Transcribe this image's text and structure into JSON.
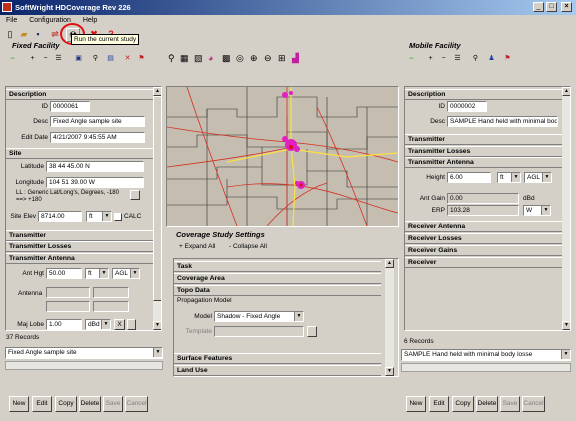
{
  "window": {
    "title": "SoftWright HDCoverage Rev 226",
    "min": "_",
    "max": "□",
    "close": "×"
  },
  "menu": [
    "File",
    "Configuration",
    "Help"
  ],
  "tooltip": "Run the current study",
  "fixed": {
    "panel_title": "Fixed Facility",
    "description": {
      "heading": "Description",
      "id_label": "ID",
      "id": "0000061",
      "desc_label": "Desc",
      "desc": "Fixed Angle sample site",
      "date_label": "Edit Date",
      "date": "4/21/2007 9:45:55 AM"
    },
    "site": {
      "heading": "Site",
      "lat_label": "Latitude",
      "lat": "38 44 45.00 N",
      "lon_label": "Longitude",
      "lon": "104 51 39.00 W",
      "ll_label": "LL : Generic Lat/Long's, Degrees, -180 ==> +180",
      "elev_label": "Site Elev",
      "elev": "8714.00",
      "elev_unit": "ft",
      "calc": "CALC"
    },
    "transmitter": "Transmitter",
    "losses": "Transmitter Losses",
    "antenna": {
      "heading": "Transmitter Antenna",
      "hgt_label": "Ant Hgt",
      "hgt": "50.00",
      "hgt_unit": "ft",
      "hgt_ref": "AGL",
      "antenna_label": "Antenna",
      "lobe_label": "Maj Lobe",
      "lobe": "1.00",
      "lobe_unit": "dBd",
      "x": "X"
    },
    "records": "37 Records",
    "selected": "Fixed Angle sample site"
  },
  "buttons": {
    "new": "New",
    "edit": "Edit",
    "copy": "Copy",
    "delete": "Delete",
    "save": "Save",
    "cancel": "Cancel"
  },
  "study": {
    "panel_title": "Coverage Study Settings",
    "expand": "Expand All",
    "collapse": "Collapse All",
    "task": "Task",
    "area": "Coverage Area",
    "topo": "Topo Data",
    "prop": "Propagation Model",
    "model_label": "Model",
    "model": "Shadow - Fixed Angle",
    "template_label": "Template",
    "surface": "Surface Features",
    "land": "Land Use"
  },
  "mobile": {
    "panel_title": "Mobile Facility",
    "description": {
      "heading": "Description",
      "id_label": "ID",
      "id": "0000002",
      "desc_label": "Desc",
      "desc": "SAMPLE Hand held with minimal bod"
    },
    "transmitter": "Transmitter",
    "losses": "Transmitter Losses",
    "antenna": {
      "heading": "Transmitter Antenna",
      "height_label": "Height",
      "height": "6.00",
      "height_unit": "ft",
      "height_ref": "AGL",
      "gain_label": "Ant Gain",
      "gain": "0.00",
      "gain_unit": "dBd",
      "erp_label": "ERP",
      "erp": "103.28",
      "erp_unit": "W"
    },
    "rx_antenna": "Receiver Antenna",
    "rx_losses": "Receiver Losses",
    "rx_gains": "Receiver Gains",
    "receiver": "Receiver",
    "records": "6 Records",
    "selected": "SAMPLE Hand held with minimal body losse"
  },
  "colors": {
    "title_start": "#0a246a",
    "title_end": "#a6caf0",
    "map_bg": "#c4bdb0",
    "roads": "#d43020",
    "hwy": "#ffe040",
    "coverage": "#e020c0",
    "highlight": "#e01010"
  }
}
